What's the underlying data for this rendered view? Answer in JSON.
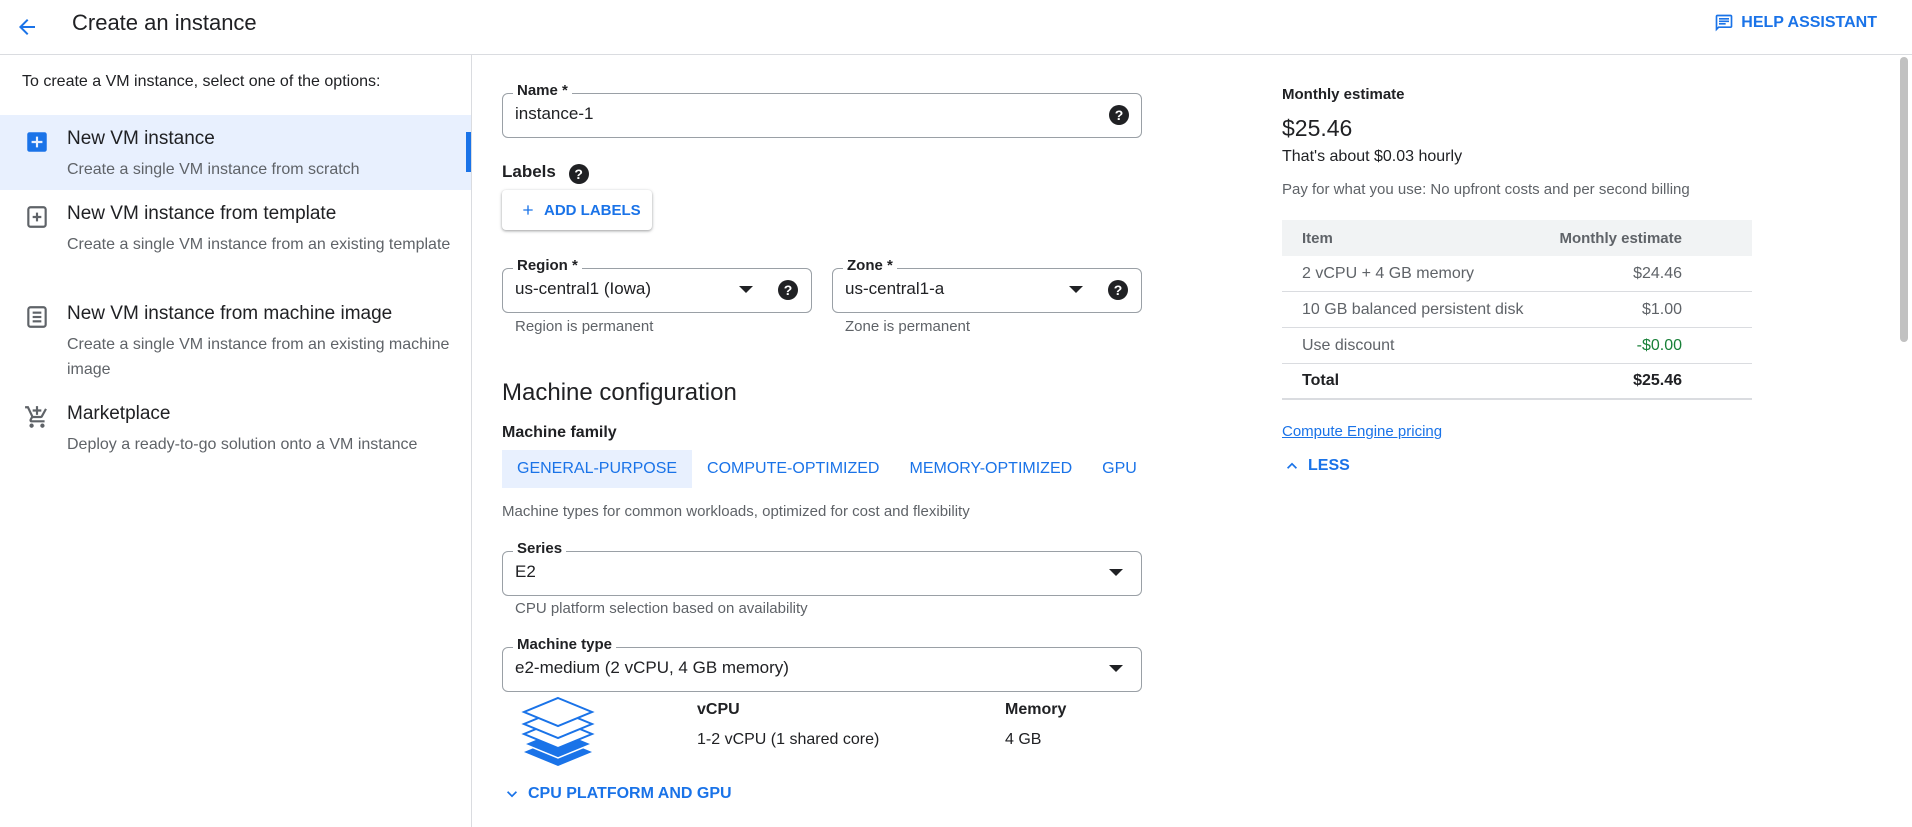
{
  "header": {
    "title": "Create an instance",
    "help_label": "HELP ASSISTANT"
  },
  "sidebar": {
    "intro": "To create a VM instance, select one of the options:",
    "options": [
      {
        "title": "New VM instance",
        "desc": "Create a single VM instance from scratch",
        "icon": "add-box-icon",
        "selected": true
      },
      {
        "title": "New VM instance from template",
        "desc": "Create a single VM instance from an existing template",
        "icon": "template-icon",
        "selected": false
      },
      {
        "title": "New VM instance from machine image",
        "desc": "Create a single VM instance from an existing machine image",
        "icon": "machine-image-icon",
        "selected": false
      },
      {
        "title": "Marketplace",
        "desc": "Deploy a ready-to-go solution onto a VM instance",
        "icon": "cart-icon",
        "selected": false
      }
    ]
  },
  "form": {
    "name": {
      "label": "Name *",
      "value": "instance-1"
    },
    "labels": {
      "title": "Labels",
      "add_label": "ADD LABELS"
    },
    "region": {
      "label": "Region *",
      "value": "us-central1 (Iowa)",
      "helper": "Region is permanent"
    },
    "zone": {
      "label": "Zone *",
      "value": "us-central1-a",
      "helper": "Zone is permanent"
    },
    "machine_config": {
      "title": "Machine configuration",
      "family_label": "Machine family",
      "tabs": [
        "GENERAL-PURPOSE",
        "COMPUTE-OPTIMIZED",
        "MEMORY-OPTIMIZED",
        "GPU"
      ],
      "active_tab": "GENERAL-PURPOSE",
      "family_desc": "Machine types for common workloads, optimized for cost and flexibility",
      "series": {
        "label": "Series",
        "value": "E2",
        "helper": "CPU platform selection based on availability"
      },
      "machine_type": {
        "label": "Machine type",
        "value": "e2-medium (2 vCPU, 4 GB memory)"
      },
      "specs": {
        "vcpu_label": "vCPU",
        "vcpu_value": "1-2 vCPU (1 shared core)",
        "memory_label": "Memory",
        "memory_value": "4 GB"
      },
      "cpu_platform_link": "CPU PLATFORM AND GPU"
    }
  },
  "estimate": {
    "label": "Monthly estimate",
    "price": "$25.46",
    "hourly": "That's about $0.03 hourly",
    "note": "Pay for what you use: No upfront costs and per second billing",
    "table": {
      "headers": [
        "Item",
        "Monthly estimate"
      ],
      "rows": [
        {
          "item": "2 vCPU + 4 GB memory",
          "cost": "$24.46"
        },
        {
          "item": "10 GB balanced persistent disk",
          "cost": "$1.00"
        },
        {
          "item": "Use discount",
          "cost": "-$0.00"
        },
        {
          "item": "Total",
          "cost": "$25.46"
        }
      ]
    },
    "pricing_link": "Compute Engine pricing",
    "less_label": "LESS"
  },
  "colors": {
    "accent": "#1a73e8",
    "selected_bg": "#e8f0fe",
    "discount_green": "#188038"
  }
}
